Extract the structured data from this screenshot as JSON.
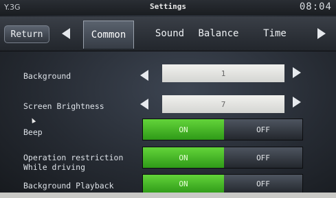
{
  "status": {
    "signal_text": "Y.3G",
    "title": "Settings",
    "clock": "08:04"
  },
  "tabs": {
    "return_label": "Return",
    "items": [
      "Common",
      "Sound",
      "Balance",
      "Time"
    ],
    "active": "Common"
  },
  "settings": {
    "background": {
      "label": "Background",
      "value": "1"
    },
    "brightness": {
      "label": "Screen Brightness",
      "value": "7"
    },
    "beep": {
      "label": "Beep",
      "on": "ON",
      "off": "OFF",
      "state": "ON"
    },
    "restriction": {
      "label_line1": "Operation restriction",
      "label_line2": "While driving",
      "on": "ON",
      "off": "OFF",
      "state": "ON"
    },
    "playback": {
      "label": "Background Playback",
      "on": "ON",
      "off": "OFF",
      "state": "ON"
    }
  },
  "colors": {
    "toggle_on": "#4cc027",
    "selector_box": "#e6e6e3"
  }
}
